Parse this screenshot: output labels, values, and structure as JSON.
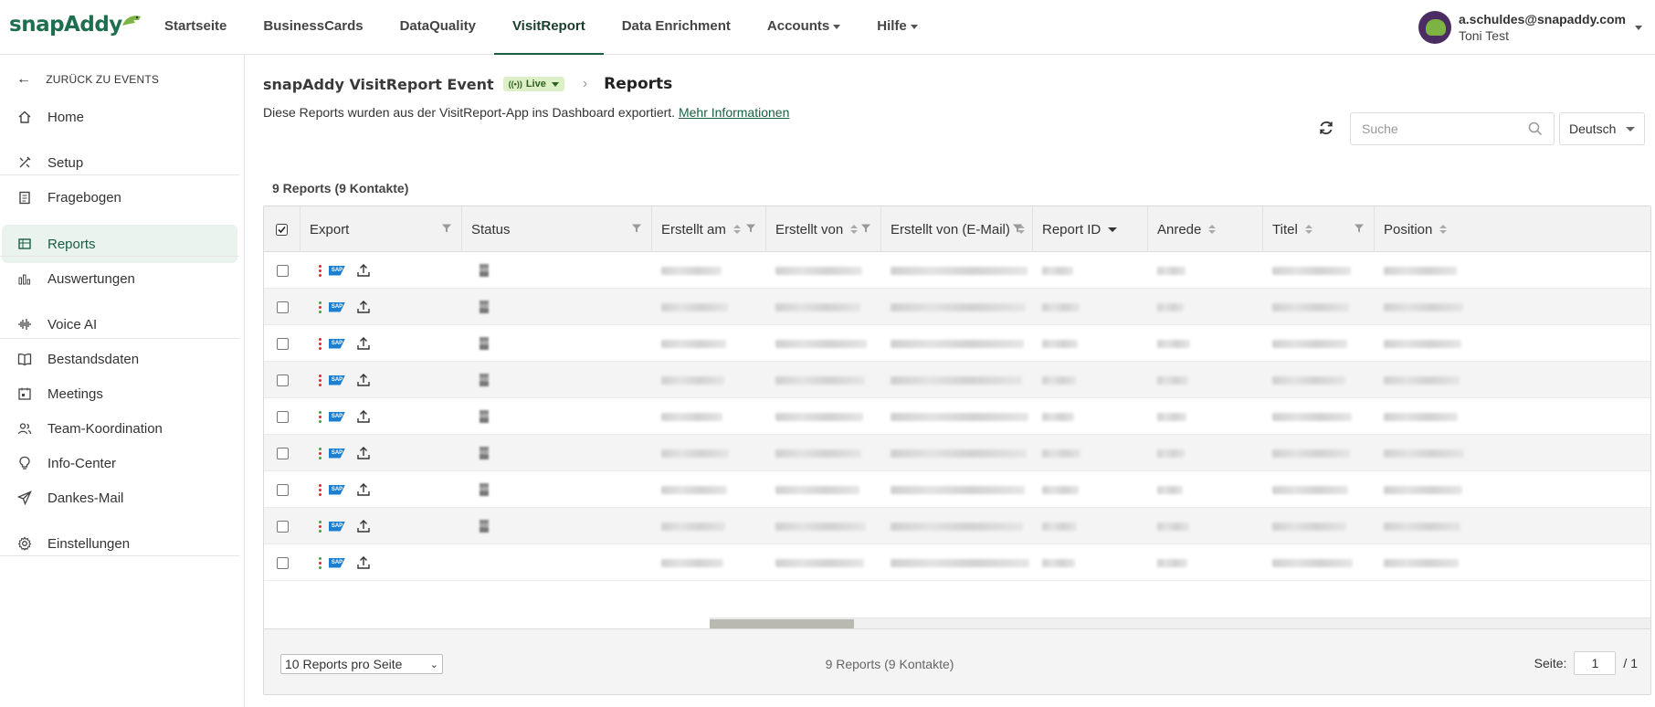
{
  "brand": {
    "name": "snapAddy"
  },
  "nav": {
    "items": [
      {
        "label": "Startseite",
        "active": false,
        "dropdown": false
      },
      {
        "label": "BusinessCards",
        "active": false,
        "dropdown": false
      },
      {
        "label": "DataQuality",
        "active": false,
        "dropdown": false
      },
      {
        "label": "VisitReport",
        "active": true,
        "dropdown": false
      },
      {
        "label": "Data Enrichment",
        "active": false,
        "dropdown": false
      },
      {
        "label": "Accounts",
        "active": false,
        "dropdown": true
      },
      {
        "label": "Hilfe",
        "active": false,
        "dropdown": true
      }
    ]
  },
  "user": {
    "email": "a.schuldes@snapaddy.com",
    "name": "Toni Test"
  },
  "sidebar": {
    "back_label": "ZURÜCK ZU EVENTS",
    "items": [
      {
        "label": "Home",
        "icon": "home-icon"
      },
      {
        "label": "Setup",
        "icon": "tools-icon"
      },
      {
        "label": "Fragebogen",
        "icon": "clipboard-icon"
      },
      {
        "label": "Reports",
        "icon": "table-icon",
        "active": true
      },
      {
        "label": "Auswertungen",
        "icon": "bar-chart-icon"
      },
      {
        "label": "Voice AI",
        "icon": "waveform-icon"
      },
      {
        "label": "Bestandsdaten",
        "icon": "book-icon"
      },
      {
        "label": "Meetings",
        "icon": "calendar-icon"
      },
      {
        "label": "Team-Koordination",
        "icon": "users-icon"
      },
      {
        "label": "Info-Center",
        "icon": "lightbulb-icon"
      },
      {
        "label": "Dankes-Mail",
        "icon": "send-icon"
      },
      {
        "label": "Einstellungen",
        "icon": "gear-icon"
      }
    ]
  },
  "header": {
    "event_title": "snapAddy VisitReport Event",
    "live_label": "Live",
    "page_title": "Reports",
    "subtitle": "Diese Reports wurden aus der VisitReport-App ins Dashboard exportiert.",
    "more_info_link": "Mehr Informationen"
  },
  "toolbar": {
    "search_placeholder": "Suche",
    "language": "Deutsch"
  },
  "summary": {
    "count_label": "9 Reports (9 Kontakte)"
  },
  "table": {
    "columns": [
      {
        "label": "Export",
        "sortable": false,
        "filter": true
      },
      {
        "label": "Status",
        "sortable": false,
        "filter": true
      },
      {
        "label": "Erstellt am",
        "sortable": true,
        "filter": true
      },
      {
        "label": "Erstellt von",
        "sortable": true,
        "filter": true
      },
      {
        "label": "Erstellt von (E-Mail)",
        "sortable": true,
        "filter": true
      },
      {
        "label": "Report ID",
        "sortable": "desc",
        "filter": false
      },
      {
        "label": "Anrede",
        "sortable": true,
        "filter": false
      },
      {
        "label": "Titel",
        "sortable": true,
        "filter": true
      },
      {
        "label": "Position",
        "sortable": true,
        "filter": false
      }
    ],
    "rows": [
      {
        "dots": "red",
        "has_status": true
      },
      {
        "dots": "mixed",
        "has_status": true
      },
      {
        "dots": "red",
        "has_status": true
      },
      {
        "dots": "red",
        "has_status": true
      },
      {
        "dots": "mixed",
        "has_status": true
      },
      {
        "dots": "mixed",
        "has_status": true
      },
      {
        "dots": "red",
        "has_status": true
      },
      {
        "dots": "mixed",
        "has_status": true
      },
      {
        "dots": "mixed",
        "has_status": false
      }
    ],
    "sap_label": "SAP"
  },
  "footer": {
    "per_page": "10 Reports pro Seite",
    "count": "9 Reports (9 Kontakte)",
    "page_label": "Seite:",
    "page_value": "1",
    "page_total": "/ 1"
  },
  "colors": {
    "brand_green": "#1b5e42",
    "accent_light": "#eaf3ee",
    "live_bg": "#dcefc7",
    "sap_blue": "#1d7fd1",
    "dot_red": "#d32f2f",
    "dot_green": "#43a047"
  }
}
